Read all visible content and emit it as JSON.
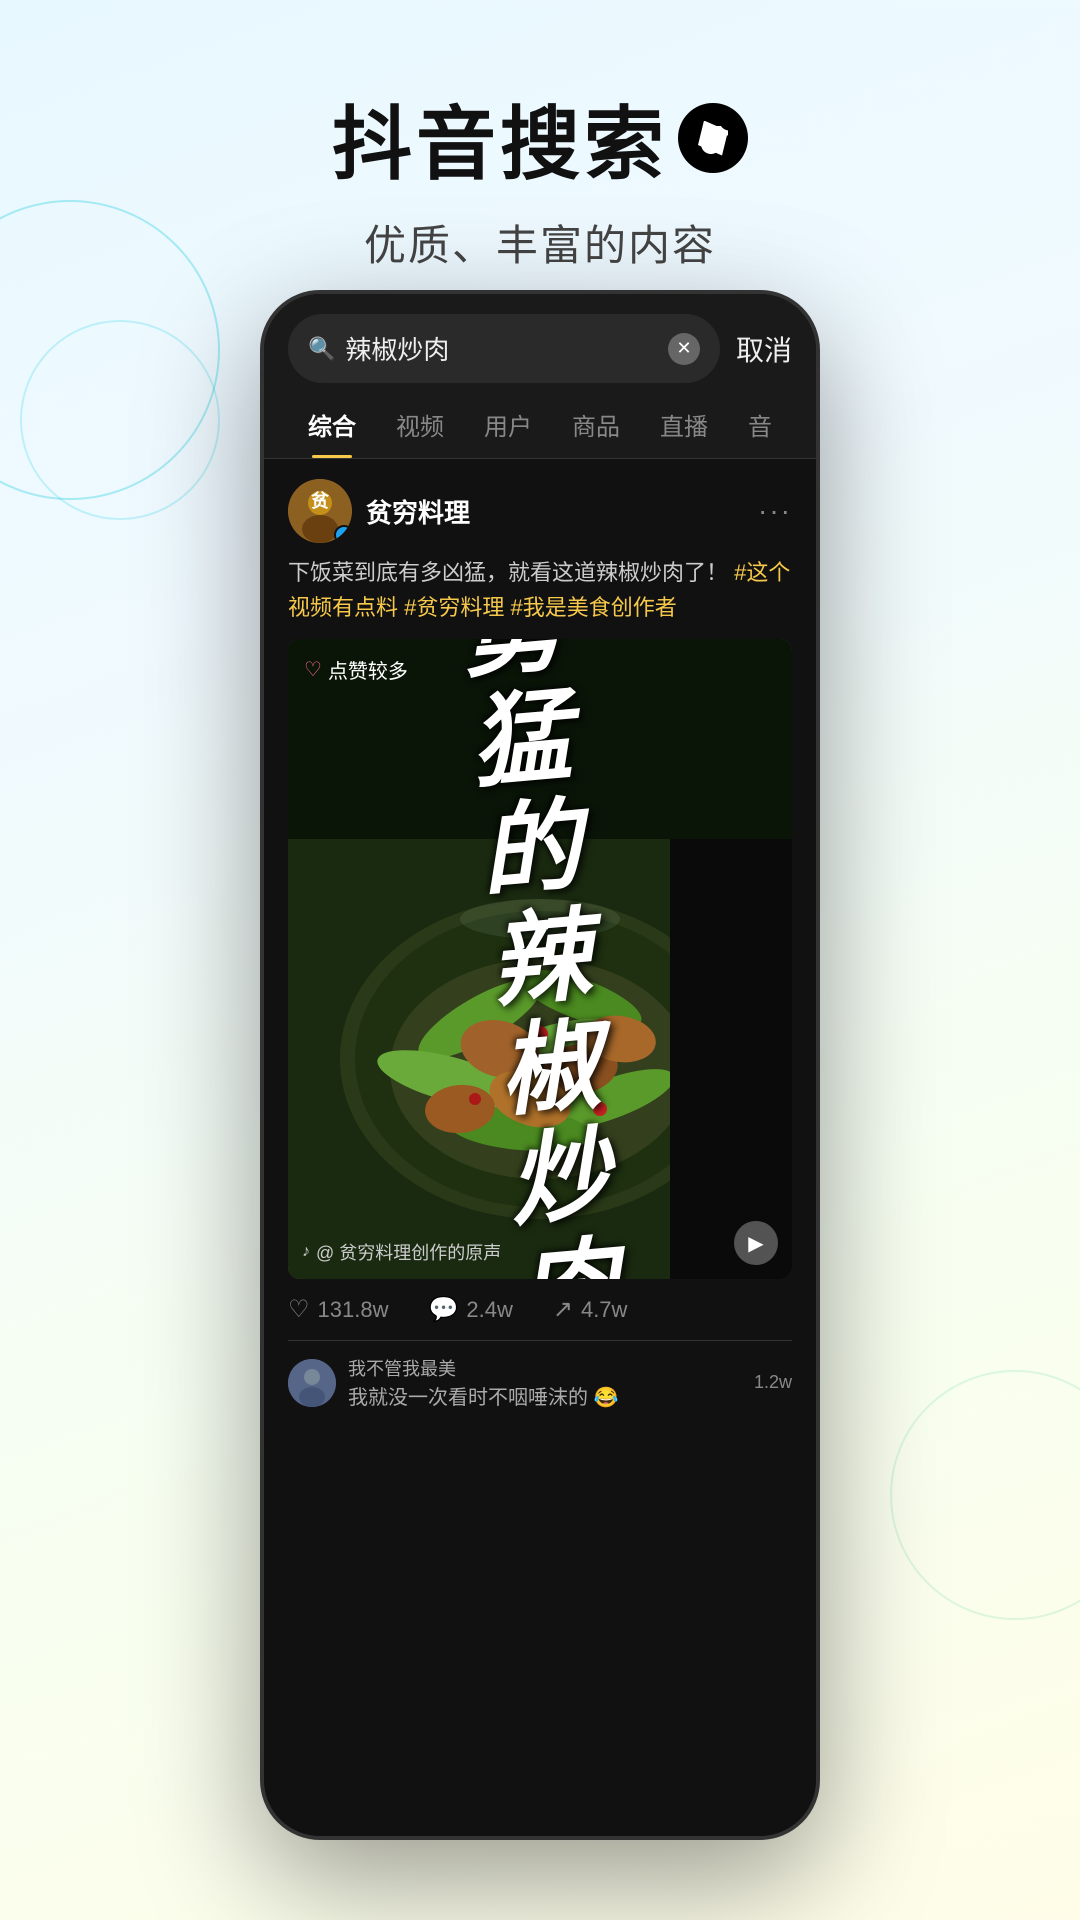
{
  "header": {
    "title": "抖音搜索",
    "logo_symbol": "♪",
    "subtitle": "优质、丰富的内容"
  },
  "phone": {
    "search_bar": {
      "query": "辣椒炒肉",
      "cancel_label": "取消",
      "placeholder": "辣椒炒肉"
    },
    "tabs": [
      {
        "label": "综合",
        "active": true
      },
      {
        "label": "视频",
        "active": false
      },
      {
        "label": "用户",
        "active": false
      },
      {
        "label": "商品",
        "active": false
      },
      {
        "label": "直播",
        "active": false
      },
      {
        "label": "音",
        "active": false
      }
    ],
    "post": {
      "user": {
        "name": "贫穷料理",
        "verified": true
      },
      "text_normal": "下饭菜到底有多凶猛，就看这道辣椒炒肉了！",
      "text_highlight": "#这个视频有点料 #贫穷料理 #我是美食创作者",
      "video": {
        "likes_badge": "点赞较多",
        "big_text": "勇猛的辣椒炒肉",
        "audio_text": "@ 贫穷料理创作的原声"
      },
      "stats": {
        "likes": "131.8w",
        "comments": "2.4w",
        "shares": "4.7w"
      },
      "comments": [
        {
          "user": "我不管我最美",
          "text": "我就没一次看时不咽唾沫的 😂",
          "likes": "1.2w"
        }
      ]
    }
  },
  "colors": {
    "accent_yellow": "#f7c94b",
    "bg_light": "#e8f8ff",
    "phone_bg": "#111111",
    "text_primary": "#ffffff",
    "text_secondary": "#cccccc",
    "text_muted": "#888888"
  }
}
